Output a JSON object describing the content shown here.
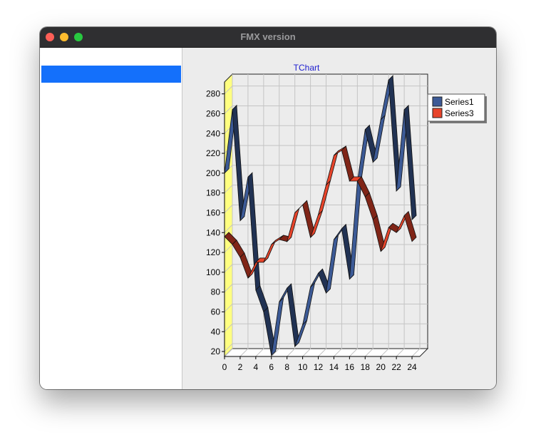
{
  "window": {
    "title": "FMX version"
  },
  "list": {
    "selected_index": 0
  },
  "legend": {
    "items": [
      "Series1",
      "Series3"
    ]
  },
  "chart_data": {
    "type": "line",
    "title": "TChart",
    "xlim": [
      0,
      25
    ],
    "ylim": [
      15,
      292
    ],
    "xticks": [
      0,
      2,
      4,
      6,
      8,
      10,
      12,
      14,
      16,
      18,
      20,
      22,
      24
    ],
    "yticks": [
      20,
      40,
      60,
      80,
      100,
      120,
      140,
      160,
      180,
      200,
      220,
      240,
      260,
      280
    ],
    "grid": true,
    "legend_position": "right",
    "view3d": true,
    "series": [
      {
        "name": "Series1",
        "color": "#3c5a96",
        "values": [
          200,
          264,
          152,
          196,
          82,
          60,
          16,
          70,
          84,
          25,
          47,
          85,
          99,
          79,
          133,
          144,
          93,
          191,
          244,
          211,
          254,
          294,
          182,
          264,
          153
        ]
      },
      {
        "name": "Series3",
        "color": "#e8442a",
        "values": [
          136,
          128,
          115,
          94,
          110,
          110,
          128,
          133,
          131,
          160,
          168,
          135,
          158,
          188,
          218,
          223,
          192,
          192,
          176,
          153,
          121,
          145,
          140,
          157,
          131
        ]
      }
    ]
  }
}
